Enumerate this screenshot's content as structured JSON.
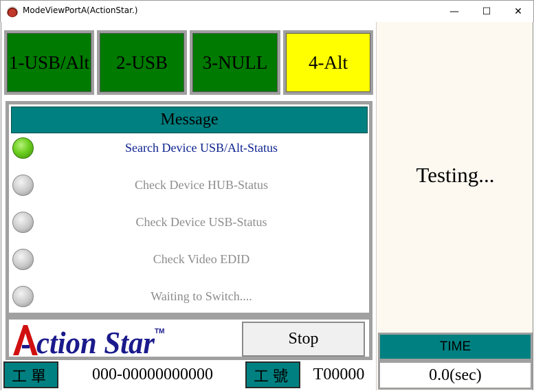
{
  "window": {
    "title": "ModeViewPortA(ActionStar.)",
    "controls": {
      "minimize": "—",
      "maximize": "☐",
      "close": "✕"
    }
  },
  "ports": [
    {
      "label": "1-USB/Alt",
      "color": "#007a00"
    },
    {
      "label": "2-USB",
      "color": "#007a00"
    },
    {
      "label": "3-NULL",
      "color": "#007a00"
    },
    {
      "label": "4-Alt",
      "color": "#ffff00"
    }
  ],
  "message": {
    "header": "Message",
    "header_color": "#008080",
    "steps": [
      {
        "label": "Search Device USB/Alt-Status",
        "state": "active",
        "led": "green-led-icon"
      },
      {
        "label": "Check Device HUB-Status",
        "state": "pending",
        "led": "gray-led-icon"
      },
      {
        "label": "Check Device USB-Status",
        "state": "pending",
        "led": "gray-led-icon"
      },
      {
        "label": "Check Video EDID",
        "state": "pending",
        "led": "gray-led-icon"
      },
      {
        "label": "Waiting to Switch....",
        "state": "pending",
        "led": "gray-led-icon"
      }
    ]
  },
  "logo": {
    "text": "Action Star",
    "trademark": "TM",
    "brand_color": "#1a1a8c",
    "accent_color": "#d01010"
  },
  "stop_button": {
    "label": "Stop"
  },
  "info": {
    "work_order_label": "工單",
    "work_order_value": "000-00000000000",
    "serial_label": "工號",
    "serial_value": "T00000"
  },
  "status": {
    "text": "Testing..."
  },
  "time": {
    "header": "TIME",
    "value": "0.0(sec)"
  }
}
